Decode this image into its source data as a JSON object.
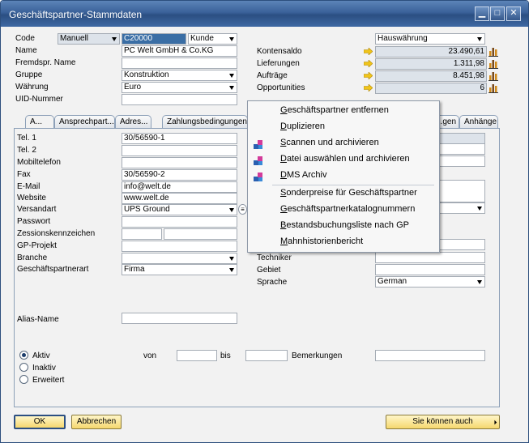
{
  "window": {
    "title": "Geschäftspartner-Stammdaten",
    "controls": {
      "minimize": "▁",
      "maximize": "□",
      "close": "✕"
    }
  },
  "header": {
    "code_label": "Code",
    "code_series": "Manuell",
    "code_value": "C20000",
    "code_type": "Kunde",
    "name_label": "Name",
    "name_value": "PC Welt GmbH & Co.KG",
    "foreign_name_label": "Fremdspr. Name",
    "foreign_name_value": "",
    "group_label": "Gruppe",
    "group_value": "Konstruktion",
    "currency_label": "Währung",
    "currency_value": "Euro",
    "vat_label": "UID-Nummer",
    "vat_value": "",
    "currency_display": "Hauswährung",
    "summary": [
      {
        "label": "Kontensaldo",
        "value": "23.490,61"
      },
      {
        "label": "Lieferungen",
        "value": "1.311,98"
      },
      {
        "label": "Aufträge",
        "value": "8.451,98"
      },
      {
        "label": "Opportunities",
        "value": "6"
      }
    ]
  },
  "tabs": [
    {
      "label": "A..."
    },
    {
      "label": "Ansprechpart..."
    },
    {
      "label": "Adres..."
    },
    {
      "label": "Zahlungsbedingungen"
    },
    {
      "label": "...gen"
    },
    {
      "label": "Anhänge"
    }
  ],
  "general": {
    "tel1_label": "Tel. 1",
    "tel1_value": "30/56590-1",
    "tel2_label": "Tel. 2",
    "tel2_value": "",
    "mobile_label": "Mobiltelefon",
    "mobile_value": "",
    "fax_label": "Fax",
    "fax_value": "30/56590-2",
    "email_label": "E-Mail",
    "email_value": "info@welt.de",
    "website_label": "Website",
    "website_value": "www.welt.de",
    "shipping_label": "Versandart",
    "shipping_value": "UPS Ground",
    "password_label": "Passwort",
    "password_value": "",
    "assignment_label": "Zessionskennzeichen",
    "project_label": "GP-Projekt",
    "project_value": "",
    "industry_label": "Branche",
    "industry_value": "",
    "bp_type_label": "Geschäftspartnerart",
    "bp_type_value": "Firma",
    "alias_label": "Alias-Name",
    "alias_value": "",
    "technician_label": "Techniker",
    "technician_value": "",
    "territory_label": "Gebiet",
    "territory_value": "",
    "language_label": "Sprache",
    "language_value": "German"
  },
  "status": {
    "active": "Aktiv",
    "inactive": "Inaktiv",
    "advanced": "Erweitert",
    "from_label": "von",
    "to_label": "bis",
    "remarks_label": "Bemerkungen"
  },
  "context_menu": {
    "items": [
      {
        "label": "Geschäftspartner entfernen",
        "icon": ""
      },
      {
        "label": "Duplizieren",
        "icon": ""
      },
      {
        "label": "Scannen und archivieren",
        "icon": "scan-archive-icon"
      },
      {
        "label": "Datei auswählen und archivieren",
        "icon": "file-archive-icon"
      },
      {
        "label": "DMS Archiv",
        "icon": "dms-archive-icon"
      },
      {
        "label": "Sonderpreise für Geschäftspartner",
        "icon": ""
      },
      {
        "label": "Geschäftspartnerkatalognummern",
        "icon": ""
      },
      {
        "label": "Bestandsbuchungsliste nach GP",
        "icon": ""
      },
      {
        "label": "Mahnhistorienbericht",
        "icon": ""
      }
    ]
  },
  "footer": {
    "ok": "OK",
    "cancel": "Abbrechen",
    "you_can_also": "Sie können auch"
  },
  "colors": {
    "titlebar": "#3a6199",
    "button": "#f5d76e",
    "arrow": "#f0c419",
    "selection": "#3a6ea5"
  }
}
